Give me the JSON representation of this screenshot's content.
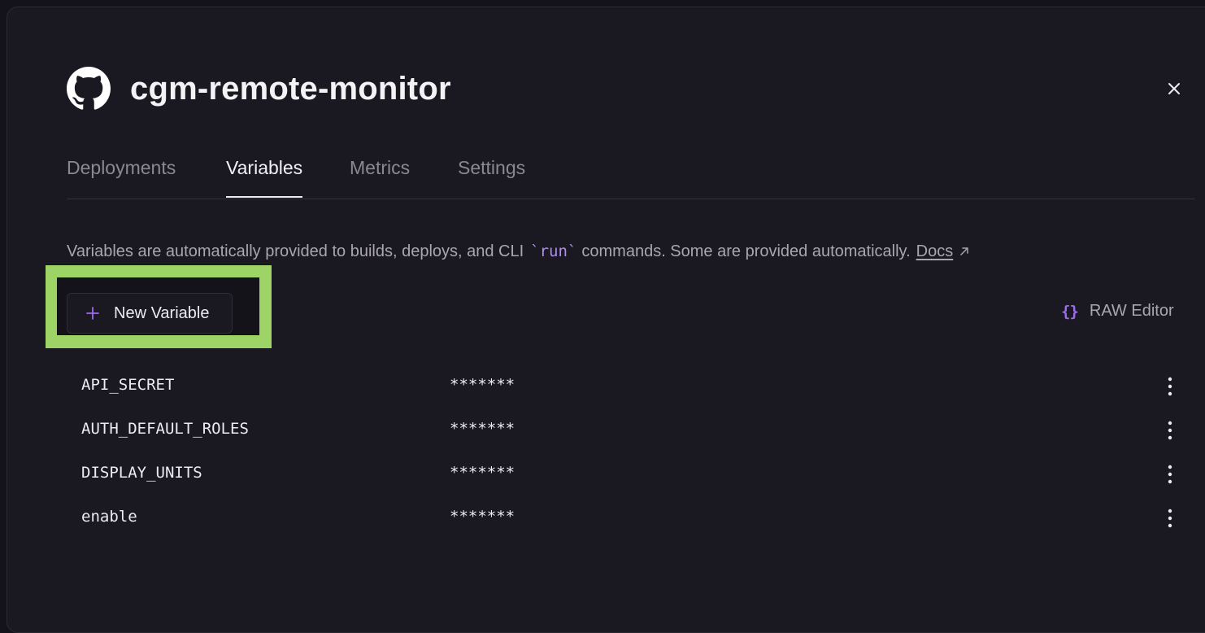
{
  "header": {
    "title": "cgm-remote-monitor",
    "icon": "github-icon"
  },
  "tabs": [
    {
      "label": "Deployments",
      "active": false
    },
    {
      "label": "Variables",
      "active": true
    },
    {
      "label": "Metrics",
      "active": false
    },
    {
      "label": "Settings",
      "active": false
    }
  ],
  "description": {
    "before": "Variables are automatically provided to builds, deploys, and CLI",
    "code": "`run`",
    "after": "commands. Some are provided automatically.",
    "docs_link": "Docs"
  },
  "actions": {
    "new_variable": "New Variable",
    "raw_editor": "RAW Editor",
    "raw_editor_icon": "{}"
  },
  "variables": [
    {
      "name": "API_SECRET",
      "value": "*******"
    },
    {
      "name": "AUTH_DEFAULT_ROLES",
      "value": "*******"
    },
    {
      "name": "DISPLAY_UNITS",
      "value": "*******"
    },
    {
      "name": "enable",
      "value": "*******"
    }
  ],
  "colors": {
    "background": "#1a1821",
    "accent": "#9b6cf0",
    "highlight": "#9ed466"
  }
}
